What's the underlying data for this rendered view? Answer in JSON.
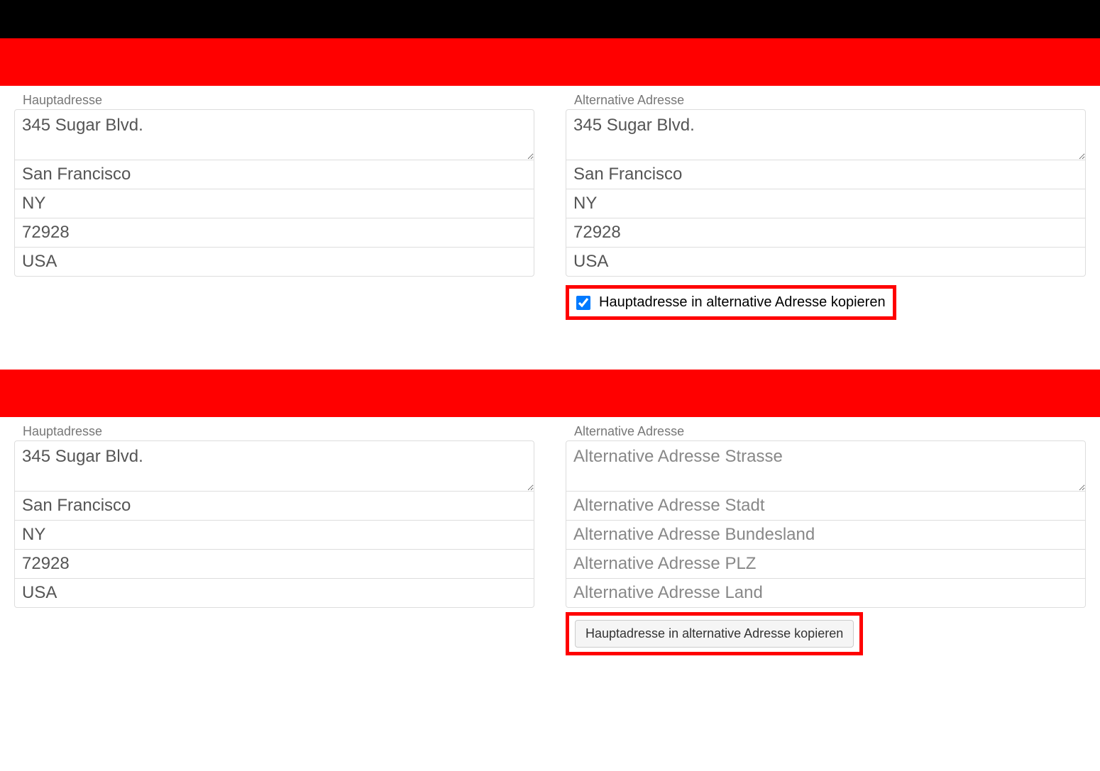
{
  "section1": {
    "main": {
      "label": "Hauptadresse",
      "street": "345 Sugar Blvd.",
      "city": "San Francisco",
      "state": "NY",
      "postal": "72928",
      "country": "USA"
    },
    "alt": {
      "label": "Alternative Adresse",
      "street": "345 Sugar Blvd.",
      "city": "San Francisco",
      "state": "NY",
      "postal": "72928",
      "country": "USA"
    },
    "checkbox_label": "Hauptadresse in alternative Adresse kopieren",
    "checkbox_checked": true
  },
  "section2": {
    "main": {
      "label": "Hauptadresse",
      "street": "345 Sugar Blvd.",
      "city": "San Francisco",
      "state": "NY",
      "postal": "72928",
      "country": "USA"
    },
    "alt": {
      "label": "Alternative Adresse",
      "street_placeholder": "Alternative Adresse Strasse",
      "city_placeholder": "Alternative Adresse Stadt",
      "state_placeholder": "Alternative Adresse Bundesland",
      "postal_placeholder": "Alternative Adresse PLZ",
      "country_placeholder": "Alternative Adresse Land"
    },
    "button_label": "Hauptadresse in alternative Adresse kopieren"
  }
}
